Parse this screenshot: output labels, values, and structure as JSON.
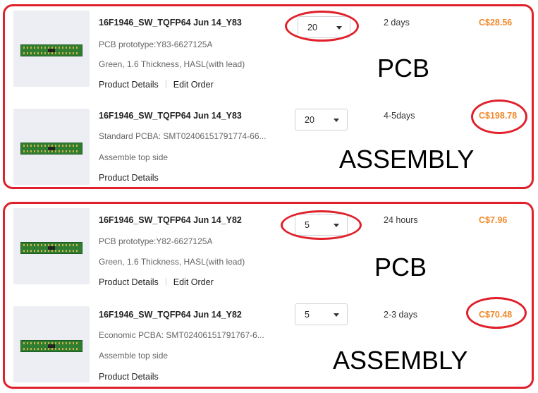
{
  "colors": {
    "annotation": "#e0202a",
    "price": "#f08a2c",
    "thumb_bg": "#edeef3"
  },
  "groups": [
    {
      "label_pcb": "PCB",
      "label_assembly": "ASSEMBLY",
      "pcb": {
        "title": "16F1946_SW_TQFP64 Jun 14_Y83",
        "type_line": "PCB prototype:Y83-6627125A",
        "spec_line": "Green, 1.6 Thickness, HASL(with lead)",
        "link_details": "Product Details",
        "link_edit": "Edit Order",
        "qty": "20",
        "days": "2 days",
        "price": "C$28.56"
      },
      "assembly": {
        "title": "16F1946_SW_TQFP64 Jun 14_Y83",
        "type_line": "Standard PCBA: SMT02406151791774-66...",
        "spec_line": "Assemble top side",
        "link_details": "Product Details",
        "qty": "20",
        "days": "4-5days",
        "price": "C$198.78"
      }
    },
    {
      "label_pcb": "PCB",
      "label_assembly": "ASSEMBLY",
      "pcb": {
        "title": "16F1946_SW_TQFP64 Jun 14_Y82",
        "type_line": "PCB prototype:Y82-6627125A",
        "spec_line": "Green, 1.6 Thickness, HASL(with lead)",
        "link_details": "Product Details",
        "link_edit": "Edit Order",
        "qty": "5",
        "days": "24 hours",
        "price": "C$7.96"
      },
      "assembly": {
        "title": "16F1946_SW_TQFP64 Jun 14_Y82",
        "type_line": "Economic PCBA: SMT02406151791767-6...",
        "spec_line": "Assemble top side",
        "link_details": "Product Details",
        "qty": "5",
        "days": "2-3 days",
        "price": "C$70.48"
      }
    }
  ]
}
